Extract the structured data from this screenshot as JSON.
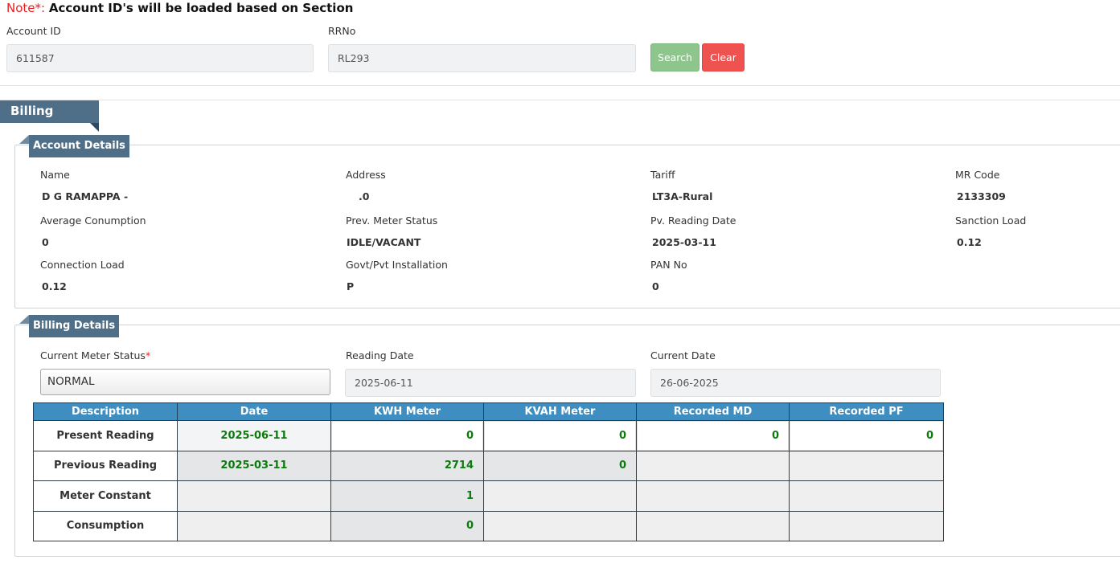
{
  "note": {
    "prefix": "Note*:",
    "message": "Account ID's will be loaded based on Section"
  },
  "search_form": {
    "account_id_label": "Account ID",
    "account_id_value": "611587",
    "rrno_label": "RRNo",
    "rrno_value": "RL293",
    "search_button": "Search",
    "clear_button": "Clear"
  },
  "section_title": "Billing Details",
  "account_details": {
    "title": "Account Details",
    "fields": [
      {
        "label": "Name",
        "value": "D G RAMAPPA -"
      },
      {
        "label": "Address",
        "value": ".0"
      },
      {
        "label": "Tariff",
        "value": "LT3A-Rural"
      },
      {
        "label": "MR Code",
        "value": "2133309"
      },
      {
        "label": "Average Conumption",
        "value": "0"
      },
      {
        "label": "Prev. Meter Status",
        "value": "IDLE/VACANT"
      },
      {
        "label": "Pv. Reading Date",
        "value": "2025-03-11"
      },
      {
        "label": "Sanction Load",
        "value": "0.12"
      },
      {
        "label": "Connection Load",
        "value": "0.12"
      },
      {
        "label": "Govt/Pvt Installation",
        "value": "P"
      },
      {
        "label": "PAN No",
        "value": "0"
      }
    ]
  },
  "billing_details": {
    "title": "Billing Details",
    "current_meter_status_label": "Current Meter Status",
    "required_mark": "*",
    "current_meter_status_value": "NORMAL",
    "reading_date_label": "Reading Date",
    "reading_date_value": "2025-06-11",
    "current_date_label": "Current Date",
    "current_date_value": "26-06-2025",
    "table": {
      "headers": [
        "Description",
        "Date",
        "KWH Meter",
        "KVAH Meter",
        "Recorded MD",
        "Recorded PF"
      ],
      "rows": [
        [
          "Present Reading",
          "2025-06-11",
          "0",
          "0",
          "0",
          "0"
        ],
        [
          "Previous Reading",
          "2025-03-11",
          "2714",
          "0",
          "",
          ""
        ],
        [
          "Meter Constant",
          "",
          "1",
          "",
          "",
          ""
        ],
        [
          "Consumption",
          "",
          "0",
          "",
          "",
          ""
        ]
      ]
    }
  },
  "colors": {
    "header_ribbon": "#4f6f89",
    "table_header": "#3f8ec2",
    "value_green": "#0d7a0d",
    "search_button": "#8dc58d",
    "clear_button": "#ef5350",
    "required_red": "#e81e1e"
  }
}
